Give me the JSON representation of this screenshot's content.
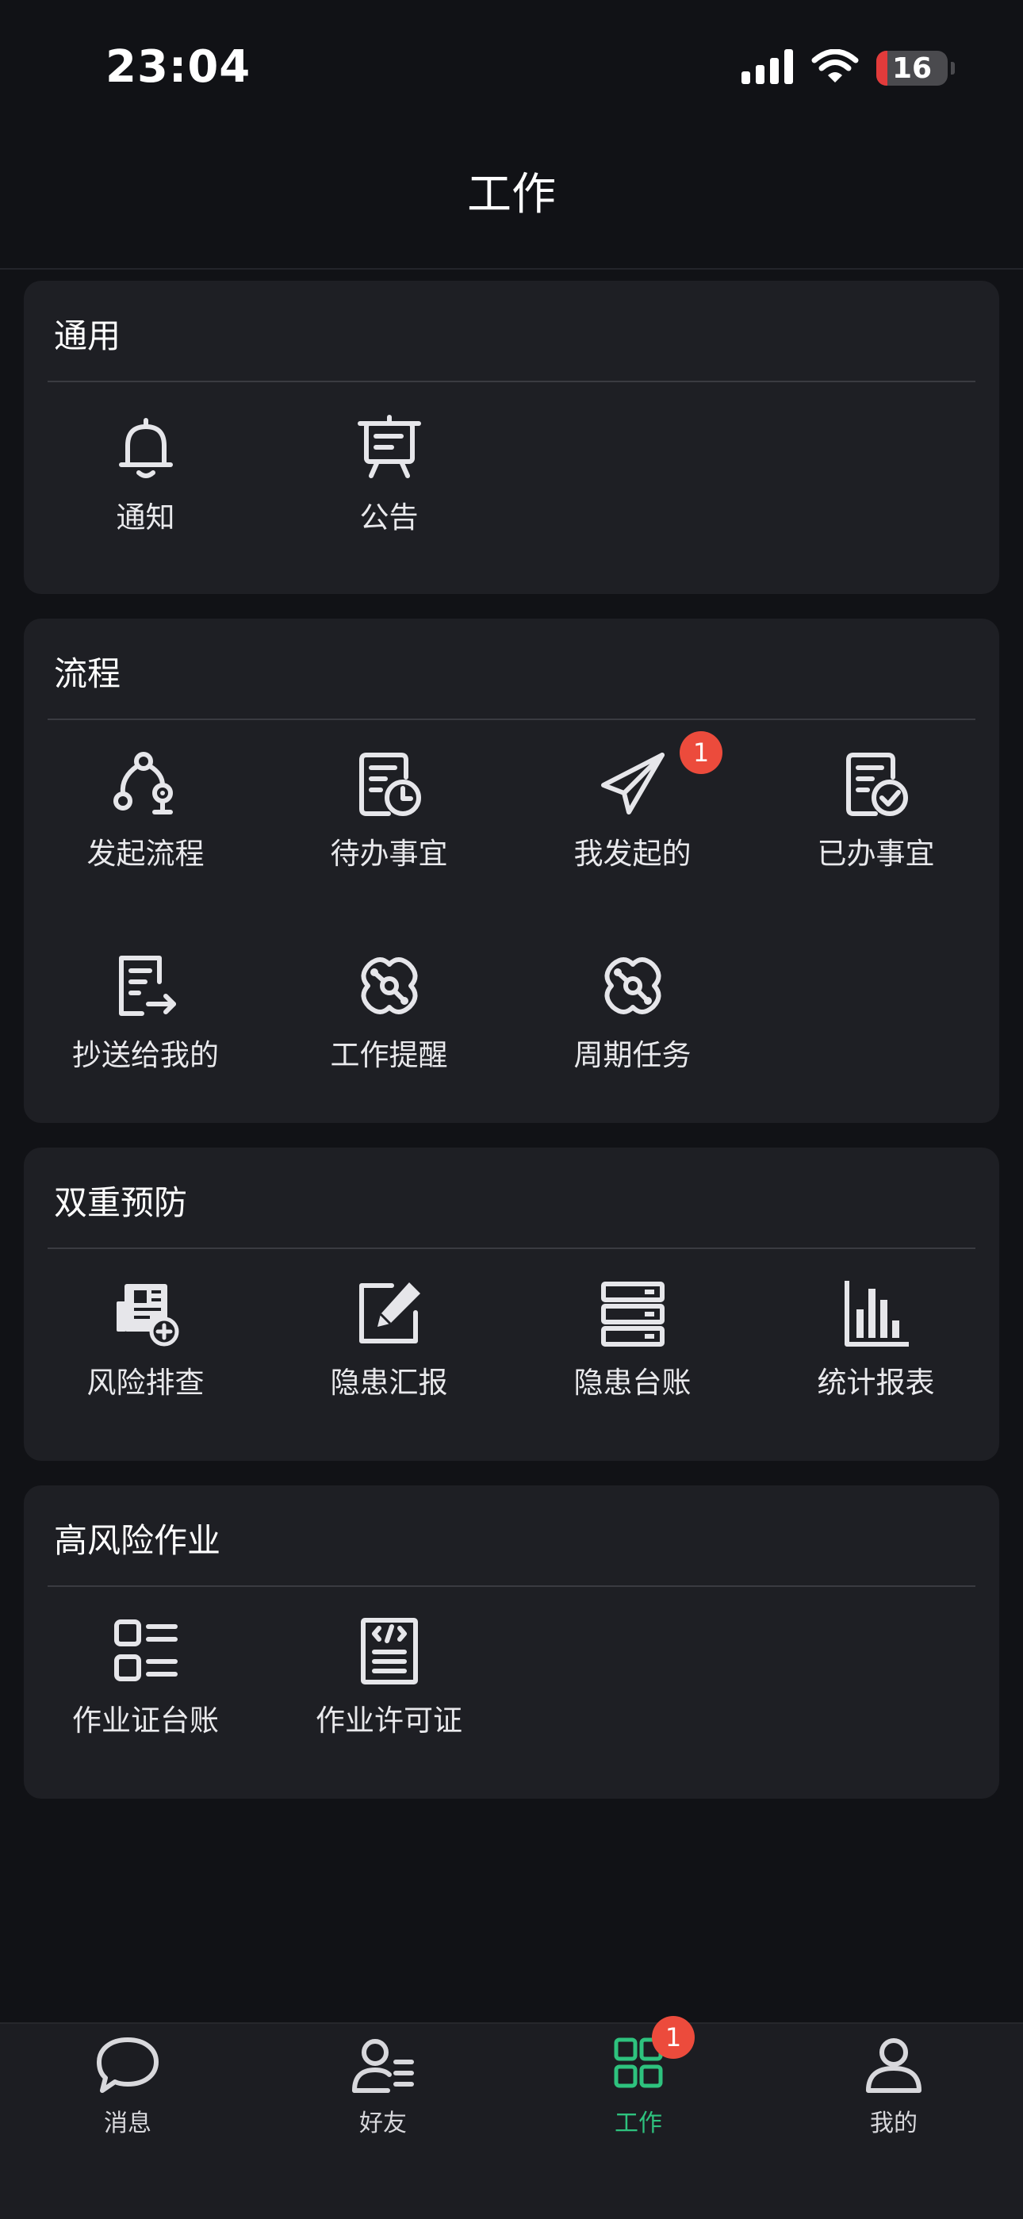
{
  "status_bar": {
    "time": "23:04",
    "battery": "16",
    "battery_level": 0.16,
    "icons": [
      "signal-icon",
      "wifi-icon",
      "battery-icon"
    ]
  },
  "header": {
    "title": "工作"
  },
  "sections": [
    {
      "title": "通用",
      "items": [
        {
          "label": "通知",
          "icon": "bell-icon"
        },
        {
          "label": "公告",
          "icon": "announcement-board-icon"
        }
      ]
    },
    {
      "title": "流程",
      "items": [
        {
          "label": "发起流程",
          "icon": "flow-start-icon"
        },
        {
          "label": "待办事宜",
          "icon": "todo-clock-icon"
        },
        {
          "label": "我发起的",
          "icon": "paper-plane-icon",
          "badge": "1"
        },
        {
          "label": "已办事宜",
          "icon": "done-check-icon"
        },
        {
          "label": "抄送给我的",
          "icon": "cc-document-icon"
        },
        {
          "label": "工作提醒",
          "icon": "reminder-orbit-icon"
        },
        {
          "label": "周期任务",
          "icon": "cycle-task-icon"
        }
      ]
    },
    {
      "title": "双重预防",
      "items": [
        {
          "label": "风险排查",
          "icon": "risk-check-icon"
        },
        {
          "label": "隐患汇报",
          "icon": "edit-report-icon"
        },
        {
          "label": "隐患台账",
          "icon": "ledger-stack-icon"
        },
        {
          "label": "统计报表",
          "icon": "bar-chart-icon"
        }
      ]
    },
    {
      "title": "高风险作业",
      "items": [
        {
          "label": "作业证台账",
          "icon": "list-grid-icon"
        },
        {
          "label": "作业许可证",
          "icon": "permit-code-icon"
        }
      ]
    }
  ],
  "tab_bar": {
    "tabs": [
      {
        "label": "消息",
        "icon": "chat-bubble-icon"
      },
      {
        "label": "好友",
        "icon": "contacts-icon"
      },
      {
        "label": "工作",
        "icon": "apps-grid-icon",
        "badge": "1",
        "active": true
      },
      {
        "label": "我的",
        "icon": "person-icon"
      }
    ]
  },
  "colors": {
    "background": "#111216",
    "card": "#1e1f24",
    "accent": "#2ec27e",
    "badge": "#ec4b3c",
    "battery_low": "#e23b3b"
  }
}
